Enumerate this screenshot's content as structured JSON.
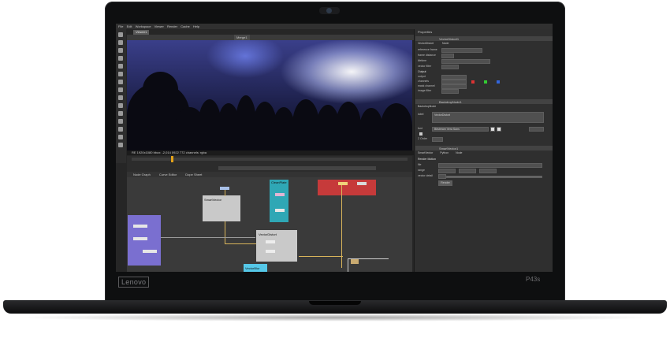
{
  "laptop": {
    "brand_logo": "Lenovo",
    "model": "P43s"
  },
  "app": {
    "menu": [
      "File",
      "Edit",
      "Workspace",
      "Viewer",
      "Render",
      "Cache",
      "Help"
    ],
    "active_tab": "Viewer1",
    "viewer_input": "Merge1",
    "viewer_info": "RE 1920x1080 bbox: -2,014 0922 772 channels: rgba",
    "node_tabs": [
      "Node Graph",
      "Curve Editor",
      "Dope Sheet"
    ],
    "properties_title": "Properties",
    "panels": [
      {
        "name": "VectorDistort1",
        "tabs": [
          "VectorDistort",
          "Node"
        ],
        "rows": [
          "reference frame",
          "frame distance",
          "lifetime",
          "vector filter",
          "Output",
          "output",
          "channels",
          "mask channel",
          "image filter"
        ]
      },
      {
        "name": "BackdropNode1",
        "tabs": [
          "BackdropNode"
        ],
        "rows": [
          "label",
          "font",
          "Z Order"
        ],
        "label_value": "VectorDistort",
        "font_value": "Bitstream Vera Sans"
      },
      {
        "name": "SmartVector1",
        "tabs": [
          "SmartVector",
          "Python",
          "Node"
        ],
        "rows": [
          "Render Motion",
          "file",
          "range",
          "vector detail"
        ],
        "render_button": "Render"
      }
    ],
    "nodes": [
      "SmartVector",
      "VectorDistort",
      "CleanPlate",
      "VectorBlur"
    ]
  },
  "colors": {
    "accent_orange": "#e3a21a",
    "node_blue": "#7a6fd0",
    "node_cyan": "#2fa7b5",
    "node_red": "#c63a3a",
    "node_grey": "#c9c9c9"
  }
}
